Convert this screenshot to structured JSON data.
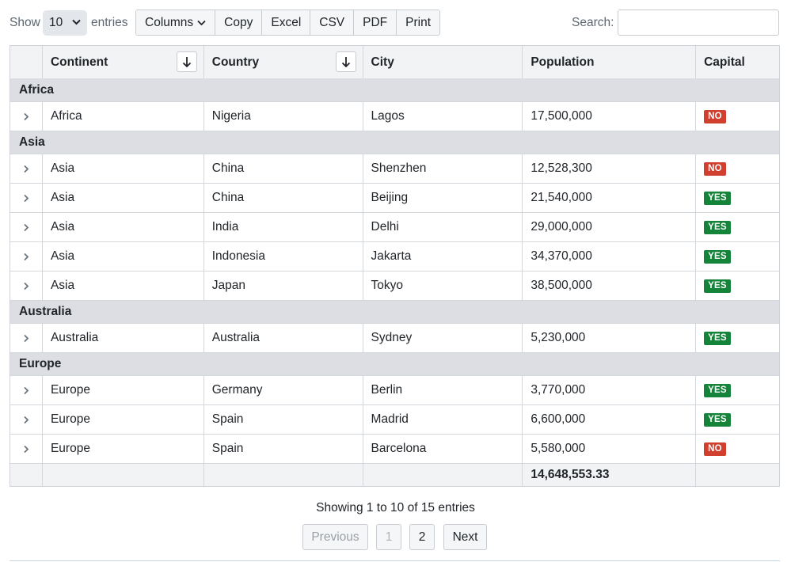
{
  "length_menu": {
    "show_label": "Show",
    "value": "10",
    "entries_label": "entries"
  },
  "buttons": [
    "Columns",
    "Copy",
    "Excel",
    "CSV",
    "PDF",
    "Print"
  ],
  "search": {
    "label": "Search:",
    "placeholder": ""
  },
  "columns": [
    "",
    "Continent",
    "Country",
    "City",
    "Population",
    "Capital"
  ],
  "sorted_columns": [
    "Continent",
    "Country"
  ],
  "groups": [
    {
      "name": "Africa",
      "rows": [
        {
          "continent": "Africa",
          "country": "Nigeria",
          "city": "Lagos",
          "population": "17,500,000",
          "capital": "NO"
        }
      ]
    },
    {
      "name": "Asia",
      "rows": [
        {
          "continent": "Asia",
          "country": "China",
          "city": "Shenzhen",
          "population": "12,528,300",
          "capital": "NO"
        },
        {
          "continent": "Asia",
          "country": "China",
          "city": "Beijing",
          "population": "21,540,000",
          "capital": "YES"
        },
        {
          "continent": "Asia",
          "country": "India",
          "city": "Delhi",
          "population": "29,000,000",
          "capital": "YES"
        },
        {
          "continent": "Asia",
          "country": "Indonesia",
          "city": "Jakarta",
          "population": "34,370,000",
          "capital": "YES"
        },
        {
          "continent": "Asia",
          "country": "Japan",
          "city": "Tokyo",
          "population": "38,500,000",
          "capital": "YES"
        }
      ]
    },
    {
      "name": "Australia",
      "rows": [
        {
          "continent": "Australia",
          "country": "Australia",
          "city": "Sydney",
          "population": "5,230,000",
          "capital": "YES"
        }
      ]
    },
    {
      "name": "Europe",
      "rows": [
        {
          "continent": "Europe",
          "country": "Germany",
          "city": "Berlin",
          "population": "3,770,000",
          "capital": "YES"
        },
        {
          "continent": "Europe",
          "country": "Spain",
          "city": "Madrid",
          "population": "6,600,000",
          "capital": "YES"
        },
        {
          "continent": "Europe",
          "country": "Spain",
          "city": "Barcelona",
          "population": "5,580,000",
          "capital": "NO"
        }
      ]
    }
  ],
  "footer": {
    "population_average": "14,648,553.33"
  },
  "info": "Showing 1 to 10 of 15 entries",
  "pagination": {
    "previous": "Previous",
    "pages": [
      "1",
      "2"
    ],
    "current_page": "1",
    "next": "Next"
  },
  "colors": {
    "badge_no": "#d13f2f",
    "badge_yes": "#14843a",
    "group_bg": "#dcdee3",
    "header_bg": "#f2f3f5"
  },
  "icons": {
    "row_expand": "chevron-right-icon",
    "sort": "arrow-down-icon",
    "dropdown": "chevron-down-icon"
  }
}
